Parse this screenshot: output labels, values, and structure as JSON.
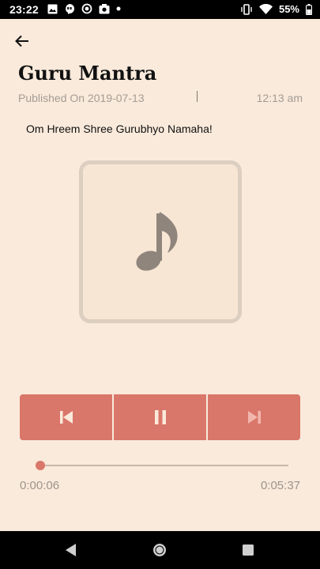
{
  "status_bar": {
    "time": "23:22",
    "battery": "55%",
    "left_icons": [
      "image-icon",
      "hangouts-icon",
      "sync-icon",
      "camera-icon",
      "dot-icon"
    ],
    "right_icons": [
      "vibrate-icon",
      "wifi-icon",
      "battery-icon"
    ]
  },
  "header": {
    "title": "Guru Mantra",
    "published": "Published On 2019-07-13",
    "published_time": "12:13 am"
  },
  "content": {
    "subtitle": "Om Hreem Shree Gurubhyo Namaha!"
  },
  "player": {
    "controls": [
      "previous-icon",
      "pause-icon",
      "next-icon"
    ],
    "progress_fraction": 0.018,
    "elapsed": "0:00:06",
    "total": "0:05:37"
  },
  "colors": {
    "background": "#faeadb",
    "accent": "#d9776a",
    "muted_text": "#a49c95"
  }
}
